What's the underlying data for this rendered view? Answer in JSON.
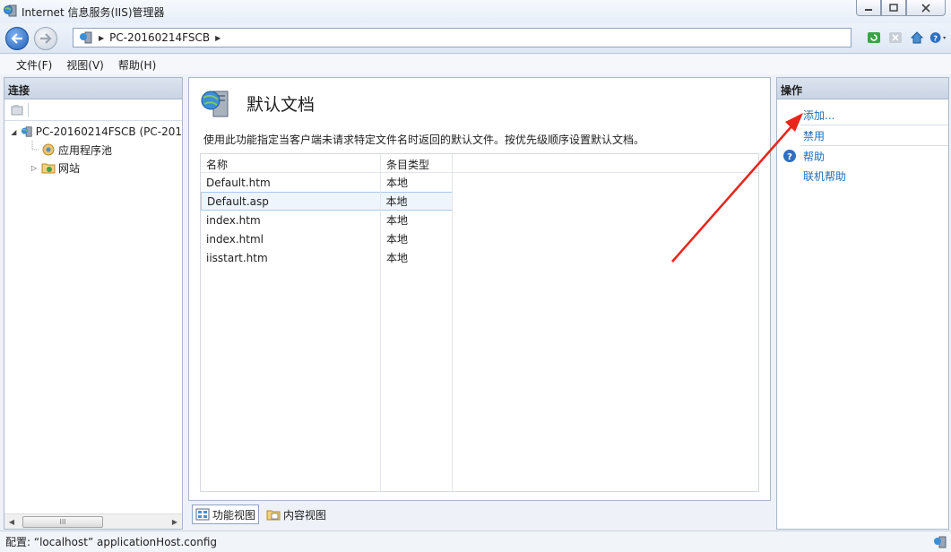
{
  "window": {
    "title": "Internet 信息服务(IIS)管理器"
  },
  "address": {
    "crumbs": [
      "PC-20160214FSCB"
    ]
  },
  "menu": {
    "items": [
      "文件(F)",
      "视图(V)",
      "帮助(H)"
    ]
  },
  "connections": {
    "header": "连接",
    "tree": {
      "server": "PC-20160214FSCB (PC-201",
      "children": [
        "应用程序池",
        "网站"
      ]
    }
  },
  "feature": {
    "title": "默认文档",
    "description": "使用此功能指定当客户端未请求特定文件名时返回的默认文件。按优先级顺序设置默认文档。",
    "columns": [
      "名称",
      "条目类型"
    ],
    "rows": [
      {
        "name": "Default.htm",
        "type": "本地"
      },
      {
        "name": "Default.asp",
        "type": "本地"
      },
      {
        "name": "index.htm",
        "type": "本地"
      },
      {
        "name": "index.html",
        "type": "本地"
      },
      {
        "name": "iisstart.htm",
        "type": "本地"
      }
    ],
    "selected_row": "Default.asp"
  },
  "view_tabs": {
    "features": "功能视图",
    "content": "内容视图"
  },
  "actions": {
    "header": "操作",
    "add": "添加...",
    "disable": "禁用",
    "help": "帮助",
    "online_help": "联机帮助"
  },
  "status": {
    "text": "配置: “localhost” applicationHost.config"
  },
  "colors": {
    "link": "#1f6fb8",
    "annotation_arrow": "#e8241b",
    "selection_bg": "#eef5fd"
  }
}
